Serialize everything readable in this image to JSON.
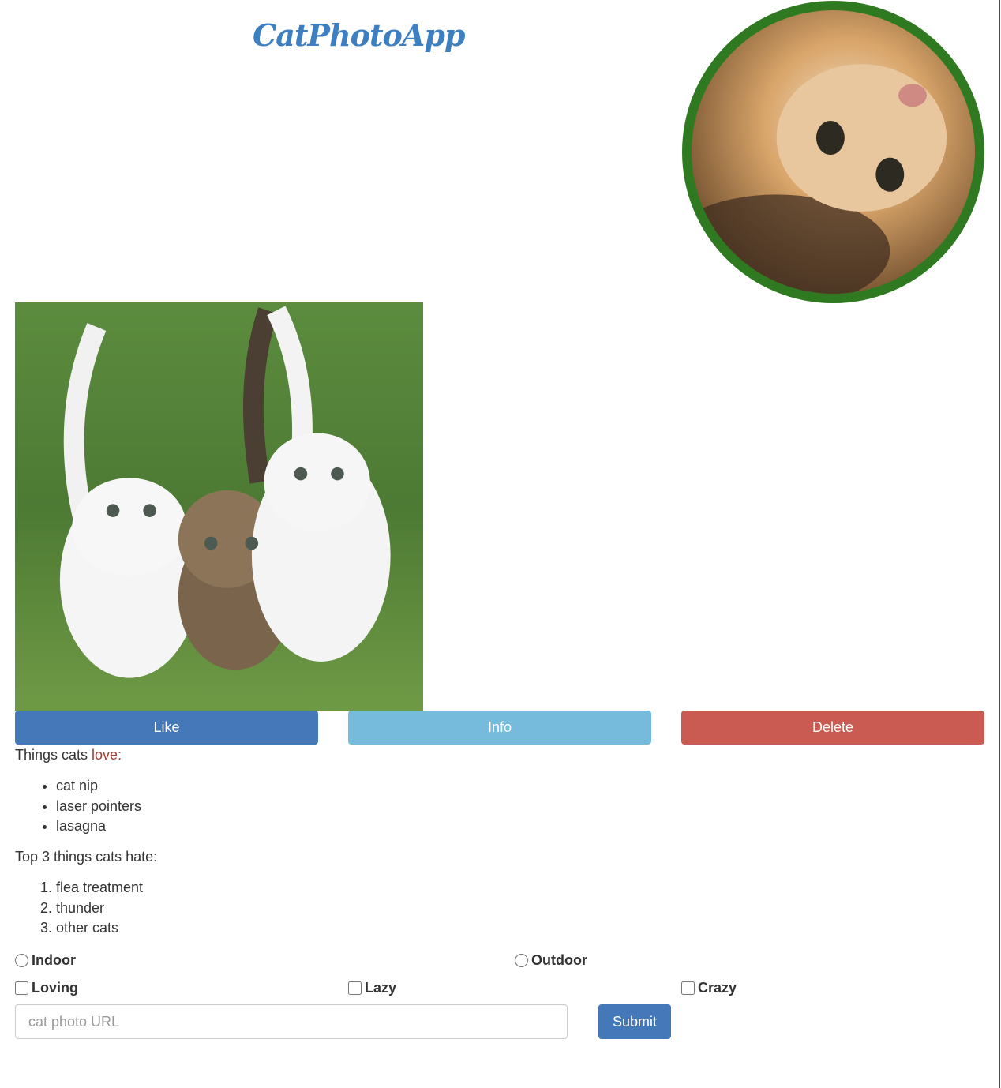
{
  "header": {
    "app_title": "CatPhotoApp"
  },
  "images": {
    "avatar_icon": "kitten-upside-down-photo",
    "main_icon": "three-kittens-photo"
  },
  "buttons": {
    "like": "Like",
    "info": "Info",
    "delete": "Delete"
  },
  "love_section": {
    "prefix": "Things cats ",
    "highlight": "love:",
    "items": [
      "cat nip",
      "laser pointers",
      "lasagna"
    ]
  },
  "hate_section": {
    "heading": "Top 3 things cats hate:",
    "items": [
      "flea treatment",
      "thunder",
      "other cats"
    ]
  },
  "form": {
    "radios": [
      {
        "label": "Indoor",
        "checked": false
      },
      {
        "label": "Outdoor",
        "checked": false
      }
    ],
    "checkboxes": [
      {
        "label": "Loving",
        "checked": false
      },
      {
        "label": "Lazy",
        "checked": false
      },
      {
        "label": "Crazy",
        "checked": false
      }
    ],
    "url_placeholder": "cat photo URL",
    "submit_label": "Submit"
  },
  "colors": {
    "title_blue": "#3d7fc0",
    "like": "#4478b8",
    "info": "#76bbdc",
    "delete": "#ca5b52",
    "avatar_border": "#2f7a20",
    "love_red": "#a23b34"
  }
}
